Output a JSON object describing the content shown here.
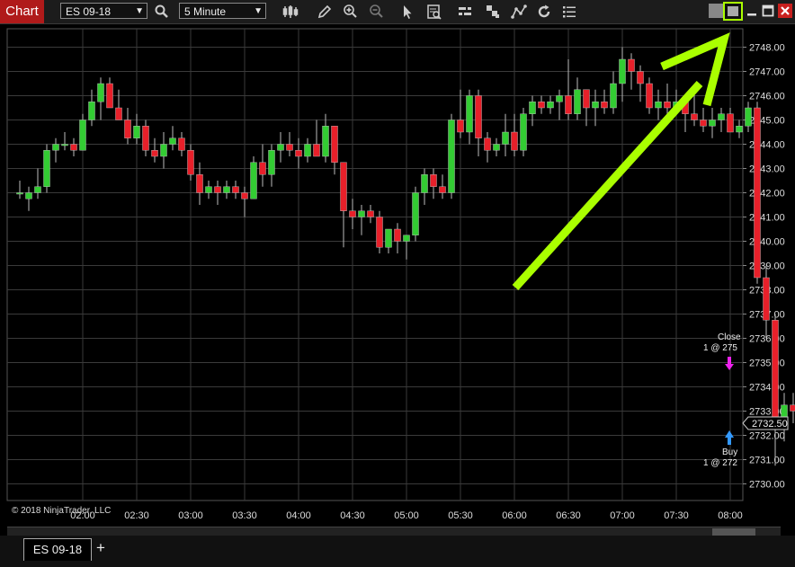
{
  "toolbar": {
    "title": "Chart",
    "instrument": "ES 09-18",
    "interval": "5 Minute",
    "icons": [
      "search-icon",
      "bar-type-icon",
      "draw-pencil-icon",
      "zoom-in-icon",
      "zoom-out-icon",
      "pointer-icon",
      "data-box-icon",
      "indicators-icon",
      "strategies-icon",
      "drawing-tools-icon",
      "refresh-icon",
      "properties-icon"
    ]
  },
  "window": {
    "buttons": [
      "tile-icon",
      "minimize-icon",
      "maximize-icon",
      "close-icon"
    ]
  },
  "colors": {
    "up": "#33cc33",
    "down": "#e8202a",
    "grid": "#3a3a3a",
    "annotation_arrow": "#aaff00",
    "close_marker": "#ee22ee",
    "buy_marker": "#3399ff",
    "chart_tab": "#b01a1a"
  },
  "footer": {
    "copyright": "© 2018 NinjaTrader, LLC",
    "tab": "ES 09-18",
    "add_tab": "+"
  },
  "chart_data": {
    "type": "candlestick",
    "y_ticks": [
      "2748.00",
      "2747.00",
      "2746.00",
      "2745.00",
      "2744.00",
      "2743.00",
      "2742.00",
      "2741.00",
      "2740.00",
      "2739.00",
      "2738.00",
      "2737.00",
      "2736.00",
      "2735.00",
      "2734.00",
      "2733.00",
      "2732.00",
      "2731.00",
      "2730.00"
    ],
    "ylim": [
      2729.5,
      2749.0
    ],
    "x_ticks": [
      "02:00",
      "02:30",
      "03:00",
      "03:30",
      "04:00",
      "04:30",
      "05:00",
      "05:30",
      "06:00",
      "06:30",
      "07:00",
      "07:30",
      "08:00"
    ],
    "last_price": "2732.50",
    "candles": [
      [
        2742.0,
        2742.5,
        2741.75,
        2742.0
      ],
      [
        2741.75,
        2742.25,
        2741.25,
        2742.0
      ],
      [
        2742.0,
        2743.0,
        2741.75,
        2742.25
      ],
      [
        2742.25,
        2744.0,
        2742.0,
        2743.75
      ],
      [
        2743.75,
        2744.25,
        2743.25,
        2744.0
      ],
      [
        2744.0,
        2744.5,
        2743.75,
        2744.0
      ],
      [
        2744.0,
        2744.25,
        2743.5,
        2743.75
      ],
      [
        2743.75,
        2745.25,
        2743.75,
        2745.0
      ],
      [
        2745.0,
        2746.25,
        2744.75,
        2745.75
      ],
      [
        2745.75,
        2746.75,
        2745.0,
        2746.5
      ],
      [
        2746.5,
        2746.75,
        2745.5,
        2745.5
      ],
      [
        2745.5,
        2746.25,
        2745.0,
        2745.0
      ],
      [
        2745.0,
        2745.5,
        2744.0,
        2744.25
      ],
      [
        2744.25,
        2745.25,
        2744.0,
        2744.75
      ],
      [
        2744.75,
        2745.0,
        2743.5,
        2743.75
      ],
      [
        2743.75,
        2744.25,
        2743.25,
        2743.5
      ],
      [
        2743.5,
        2744.5,
        2743.0,
        2744.0
      ],
      [
        2744.0,
        2744.75,
        2743.75,
        2744.25
      ],
      [
        2744.25,
        2744.5,
        2743.5,
        2743.75
      ],
      [
        2743.75,
        2744.0,
        2742.5,
        2742.75
      ],
      [
        2742.75,
        2743.25,
        2741.5,
        2742.0
      ],
      [
        2742.0,
        2742.5,
        2741.75,
        2742.25
      ],
      [
        2742.25,
        2742.5,
        2741.5,
        2742.0
      ],
      [
        2742.0,
        2742.5,
        2741.75,
        2742.25
      ],
      [
        2742.25,
        2742.5,
        2741.75,
        2742.0
      ],
      [
        2742.0,
        2742.25,
        2741.0,
        2741.75
      ],
      [
        2741.75,
        2743.5,
        2741.75,
        2743.25
      ],
      [
        2743.25,
        2744.0,
        2742.25,
        2742.75
      ],
      [
        2742.75,
        2744.0,
        2742.25,
        2743.75
      ],
      [
        2743.75,
        2744.5,
        2743.25,
        2744.0
      ],
      [
        2744.0,
        2744.5,
        2743.5,
        2743.75
      ],
      [
        2743.75,
        2744.25,
        2743.0,
        2743.5
      ],
      [
        2743.5,
        2744.25,
        2743.25,
        2744.0
      ],
      [
        2744.0,
        2745.0,
        2743.5,
        2743.5
      ],
      [
        2743.5,
        2745.25,
        2743.25,
        2744.75
      ],
      [
        2744.75,
        2744.75,
        2742.75,
        2743.25
      ],
      [
        2743.25,
        2743.25,
        2739.75,
        2741.25
      ],
      [
        2741.25,
        2741.75,
        2740.5,
        2741.0
      ],
      [
        2741.0,
        2741.5,
        2740.25,
        2741.25
      ],
      [
        2741.25,
        2741.5,
        2740.75,
        2741.0
      ],
      [
        2741.0,
        2741.25,
        2739.5,
        2739.75
      ],
      [
        2739.75,
        2740.5,
        2739.5,
        2740.5
      ],
      [
        2740.5,
        2740.75,
        2739.5,
        2740.0
      ],
      [
        2740.0,
        2740.25,
        2739.25,
        2740.25
      ],
      [
        2740.25,
        2742.25,
        2740.0,
        2742.0
      ],
      [
        2742.0,
        2743.0,
        2741.5,
        2742.75
      ],
      [
        2742.75,
        2743.0,
        2741.75,
        2742.25
      ],
      [
        2742.25,
        2742.75,
        2741.75,
        2742.0
      ],
      [
        2742.0,
        2745.25,
        2741.75,
        2745.0
      ],
      [
        2745.0,
        2746.25,
        2744.25,
        2744.5
      ],
      [
        2744.5,
        2746.25,
        2744.0,
        2746.0
      ],
      [
        2746.0,
        2746.25,
        2743.5,
        2744.25
      ],
      [
        2744.25,
        2744.5,
        2743.25,
        2743.75
      ],
      [
        2743.75,
        2744.25,
        2743.5,
        2744.0
      ],
      [
        2744.0,
        2745.25,
        2743.5,
        2744.5
      ],
      [
        2744.5,
        2745.25,
        2743.5,
        2743.75
      ],
      [
        2743.75,
        2745.5,
        2743.5,
        2745.25
      ],
      [
        2745.25,
        2746.0,
        2744.75,
        2745.75
      ],
      [
        2745.75,
        2746.0,
        2745.25,
        2745.5
      ],
      [
        2745.5,
        2746.0,
        2745.25,
        2745.75
      ],
      [
        2745.75,
        2746.25,
        2745.0,
        2746.0
      ],
      [
        2746.0,
        2747.5,
        2745.0,
        2745.25
      ],
      [
        2745.25,
        2746.75,
        2745.0,
        2746.25
      ],
      [
        2746.25,
        2746.25,
        2744.75,
        2745.5
      ],
      [
        2745.5,
        2746.25,
        2744.75,
        2745.75
      ],
      [
        2745.75,
        2746.25,
        2745.25,
        2745.5
      ],
      [
        2745.5,
        2747.0,
        2745.25,
        2746.5
      ],
      [
        2746.5,
        2748.0,
        2745.75,
        2747.5
      ],
      [
        2747.5,
        2747.75,
        2746.25,
        2747.0
      ],
      [
        2747.0,
        2747.25,
        2745.75,
        2746.5
      ],
      [
        2746.5,
        2746.75,
        2745.25,
        2745.5
      ],
      [
        2745.5,
        2746.25,
        2745.0,
        2745.75
      ],
      [
        2745.75,
        2746.5,
        2745.25,
        2745.5
      ],
      [
        2745.5,
        2746.25,
        2745.25,
        2745.75
      ],
      [
        2745.75,
        2745.75,
        2744.5,
        2745.25
      ],
      [
        2745.25,
        2746.25,
        2744.75,
        2745.0
      ],
      [
        2745.0,
        2745.5,
        2744.5,
        2744.75
      ],
      [
        2744.75,
        2745.5,
        2744.25,
        2745.0
      ],
      [
        2745.0,
        2745.5,
        2744.5,
        2745.25
      ],
      [
        2745.25,
        2745.5,
        2744.5,
        2744.5
      ],
      [
        2744.5,
        2745.0,
        2744.25,
        2744.75
      ],
      [
        2744.75,
        2745.75,
        2744.5,
        2745.5
      ],
      [
        2745.5,
        2745.75,
        2738.25,
        2738.5
      ],
      [
        2738.5,
        2739.0,
        2736.0,
        2736.75
      ],
      [
        2736.75,
        2737.0,
        2730.75,
        2732.5
      ],
      [
        2732.5,
        2733.75,
        2731.75,
        2733.25
      ],
      [
        2733.25,
        2733.75,
        2732.5,
        2733.0
      ],
      [
        2733.0,
        2734.0,
        2732.0,
        2732.5
      ]
    ],
    "annotations": [
      {
        "type": "close",
        "label": "Close",
        "fill": "1 @ 275"
      },
      {
        "type": "buy",
        "label": "Buy",
        "fill": "1 @ 272"
      }
    ]
  }
}
